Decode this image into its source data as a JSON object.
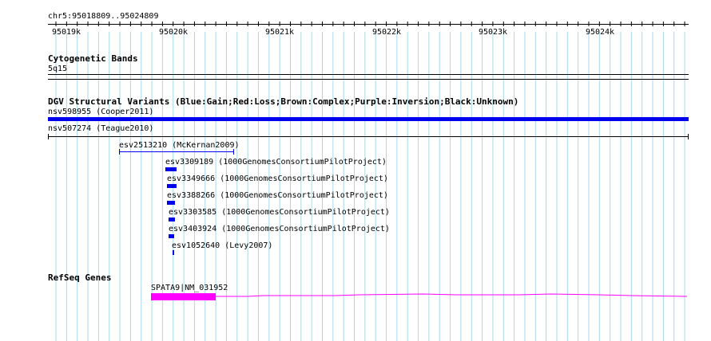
{
  "coords": "chr5:95018809..95024809",
  "ruler": {
    "ticks": [
      "95019k",
      "95020k",
      "95021k",
      "95022k",
      "95023k",
      "95024k"
    ]
  },
  "cytoband": {
    "title": "Cytogenetic Bands",
    "band": "5q15"
  },
  "dgv": {
    "title": "DGV Structural Variants (Blue:Gain;Red:Loss;Brown:Complex;Purple:Inversion;Black:Unknown)",
    "features": [
      {
        "label": "nsv598955 (Cooper2011)",
        "color": "#0000ee"
      },
      {
        "label": "nsv507274 (Teague2010)",
        "color": "#000000"
      },
      {
        "label": "esv2513210 (McKernan2009)",
        "color": "#0000ee"
      },
      {
        "label": "esv3309189 (1000GenomesConsortiumPilotProject)",
        "color": "#0000ee"
      },
      {
        "label": "esv3349666 (1000GenomesConsortiumPilotProject)",
        "color": "#0000ee"
      },
      {
        "label": "esv3388266 (1000GenomesConsortiumPilotProject)",
        "color": "#0000ee"
      },
      {
        "label": "esv3303585 (1000GenomesConsortiumPilotProject)",
        "color": "#0000ee"
      },
      {
        "label": "esv3403924 (1000GenomesConsortiumPilotProject)",
        "color": "#0000ee"
      },
      {
        "label": "esv1052640 (Levy2007)",
        "color": "#0000ee"
      }
    ]
  },
  "refseq": {
    "title": "RefSeq Genes",
    "gene": "SPATA9|NM_031952",
    "color": "#ff00ff"
  }
}
